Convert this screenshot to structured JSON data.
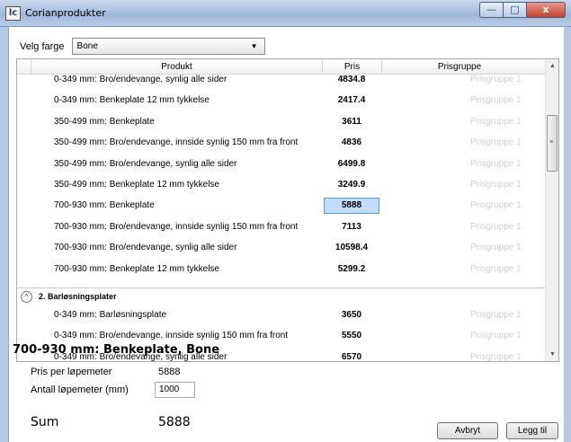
{
  "window": {
    "app_icon": "lc",
    "title": "Corianprodukter",
    "controls": {
      "minimize": "—",
      "maximize": "□",
      "close": "x"
    }
  },
  "color_select": {
    "label": "Velg farge",
    "value": "Bone"
  },
  "grid": {
    "columns": {
      "produkt": "Produkt",
      "pris": "Pris",
      "prisgruppe": "Prisgruppe"
    },
    "rows_a": [
      {
        "produkt": "0-349 mm: Bro/endevange, synlig alle sider",
        "pris": "4834.8",
        "prisgruppe": "Prisgruppe 1"
      },
      {
        "produkt": "0-349 mm: Benkeplate 12 mm tykkelse",
        "pris": "2417.4",
        "prisgruppe": "Prisgruppe 1"
      },
      {
        "produkt": "350-499 mm: Benkeplate",
        "pris": "3611",
        "prisgruppe": "Prisgruppe 1"
      },
      {
        "produkt": "350-499 mm: Bro/endevange, innside synlig 150 mm fra front",
        "pris": "4836",
        "prisgruppe": "Prisgruppe 1"
      },
      {
        "produkt": "350-499 mm: Bro/endevange, synlig alle sider",
        "pris": "6499.8",
        "prisgruppe": "Prisgruppe 1"
      },
      {
        "produkt": "350-499 mm: Benkeplate 12 mm tykkelse",
        "pris": "3249.9",
        "prisgruppe": "Prisgruppe 1"
      },
      {
        "produkt": "700-930 mm: Benkeplate",
        "pris": "5888",
        "prisgruppe": "Prisgruppe 1",
        "selected": true
      },
      {
        "produkt": "700-930 mm: Bro/endevange, innside synlig 150 mm fra front",
        "pris": "7113",
        "prisgruppe": "Prisgruppe 1"
      },
      {
        "produkt": "700-930 mm: Bro/endevange, synlig alle sider",
        "pris": "10598.4",
        "prisgruppe": "Prisgruppe 1"
      },
      {
        "produkt": "700-930 mm: Benkeplate 12 mm tykkelse",
        "pris": "5299.2",
        "prisgruppe": "Prisgruppe 1"
      }
    ],
    "group_2": {
      "toggle_glyph": "^",
      "title": "2. Barløsningsplater",
      "rows": [
        {
          "produkt": "0-349 mm: Barløsningsplate",
          "pris": "3650",
          "prisgruppe": "Prisgruppe 1"
        },
        {
          "produkt": "0-349 mm: Bro/endevange, innside synlig 150 mm fra front",
          "pris": "5550",
          "prisgruppe": "Prisgruppe 1"
        },
        {
          "produkt": "0-349 mm: Bro/endevange, synlig alle sider",
          "pris": "6570",
          "prisgruppe": "Prisgruppe 1"
        }
      ]
    },
    "scrollbar": {
      "up": "▲",
      "down": "▼",
      "grip": "≡"
    }
  },
  "detail": {
    "title": "700-930 mm: Benkeplate, Bone",
    "price_label": "Pris per løpemeter",
    "price_value": "5888",
    "qty_label": "Antall løpemeter (mm)",
    "qty_value": "1000",
    "sum_label": "Sum",
    "sum_value": "5888"
  },
  "buttons": {
    "cancel": "Avbryt",
    "add": "Legg til"
  }
}
